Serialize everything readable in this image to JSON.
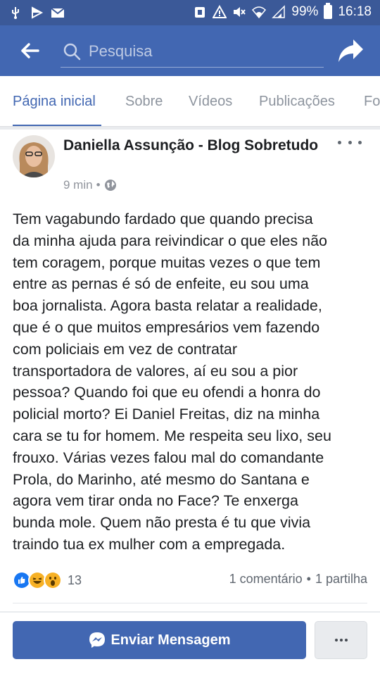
{
  "status_bar": {
    "battery": "99%",
    "time": "16:18",
    "icons": [
      "usb-icon",
      "play-icon",
      "mail-icon",
      "alarm-icon",
      "warning-icon",
      "mute-icon",
      "wifi-icon",
      "signal-icon",
      "battery-icon"
    ]
  },
  "header": {
    "search_placeholder": "Pesquisa",
    "back_icon": "back-arrow-icon",
    "share_icon": "share-arrow-icon",
    "bg_color": "#4267b2"
  },
  "tabs": [
    {
      "label": "Página inicial",
      "active": true
    },
    {
      "label": "Sobre",
      "active": false
    },
    {
      "label": "Vídeos",
      "active": false
    },
    {
      "label": "Publicações",
      "active": false
    },
    {
      "label": "Fo",
      "active": false
    }
  ],
  "post": {
    "author": "Daniella Assunção - Blog Sobretudo",
    "time": "9 min",
    "separator": "•",
    "privacy_icon": "globe-icon",
    "text": "Tem vagabundo fardado que quando precisa\nda minha ajuda para reivindicar o que eles não\ntem coragem, porque muitas vezes o que tem\nentre as pernas é só de enfeite, eu sou uma\nboa jornalista.  Agora basta relatar a realidade,\nque é o que muitos empresários vem fazendo\ncom policiais em vez de contratar\ntransportadora de valores, aí eu sou a pior\npessoa? Quando foi que eu ofendi a honra do\npolicial morto? Ei Daniel Freitas, diz na minha\ncara se tu for homem. Me respeita seu lixo, seu\nfrouxo. Várias vezes falou mal do comandante\nProla, do Marinho, até mesmo do Santana e\nagora vem tirar onda no Face? Te enxerga\nbunda mole. Quem não presta é tu que vivia\ntraindo tua ex mulher com a empregada.",
    "reactions": [
      "like",
      "haha",
      "wow"
    ],
    "reaction_count": "13",
    "comments": "1 comentário",
    "shares": "1 partilha",
    "dot": "•"
  },
  "actions": {
    "message_label": "Enviar Mensagem",
    "overflow_icon": "more-dots-icon"
  }
}
